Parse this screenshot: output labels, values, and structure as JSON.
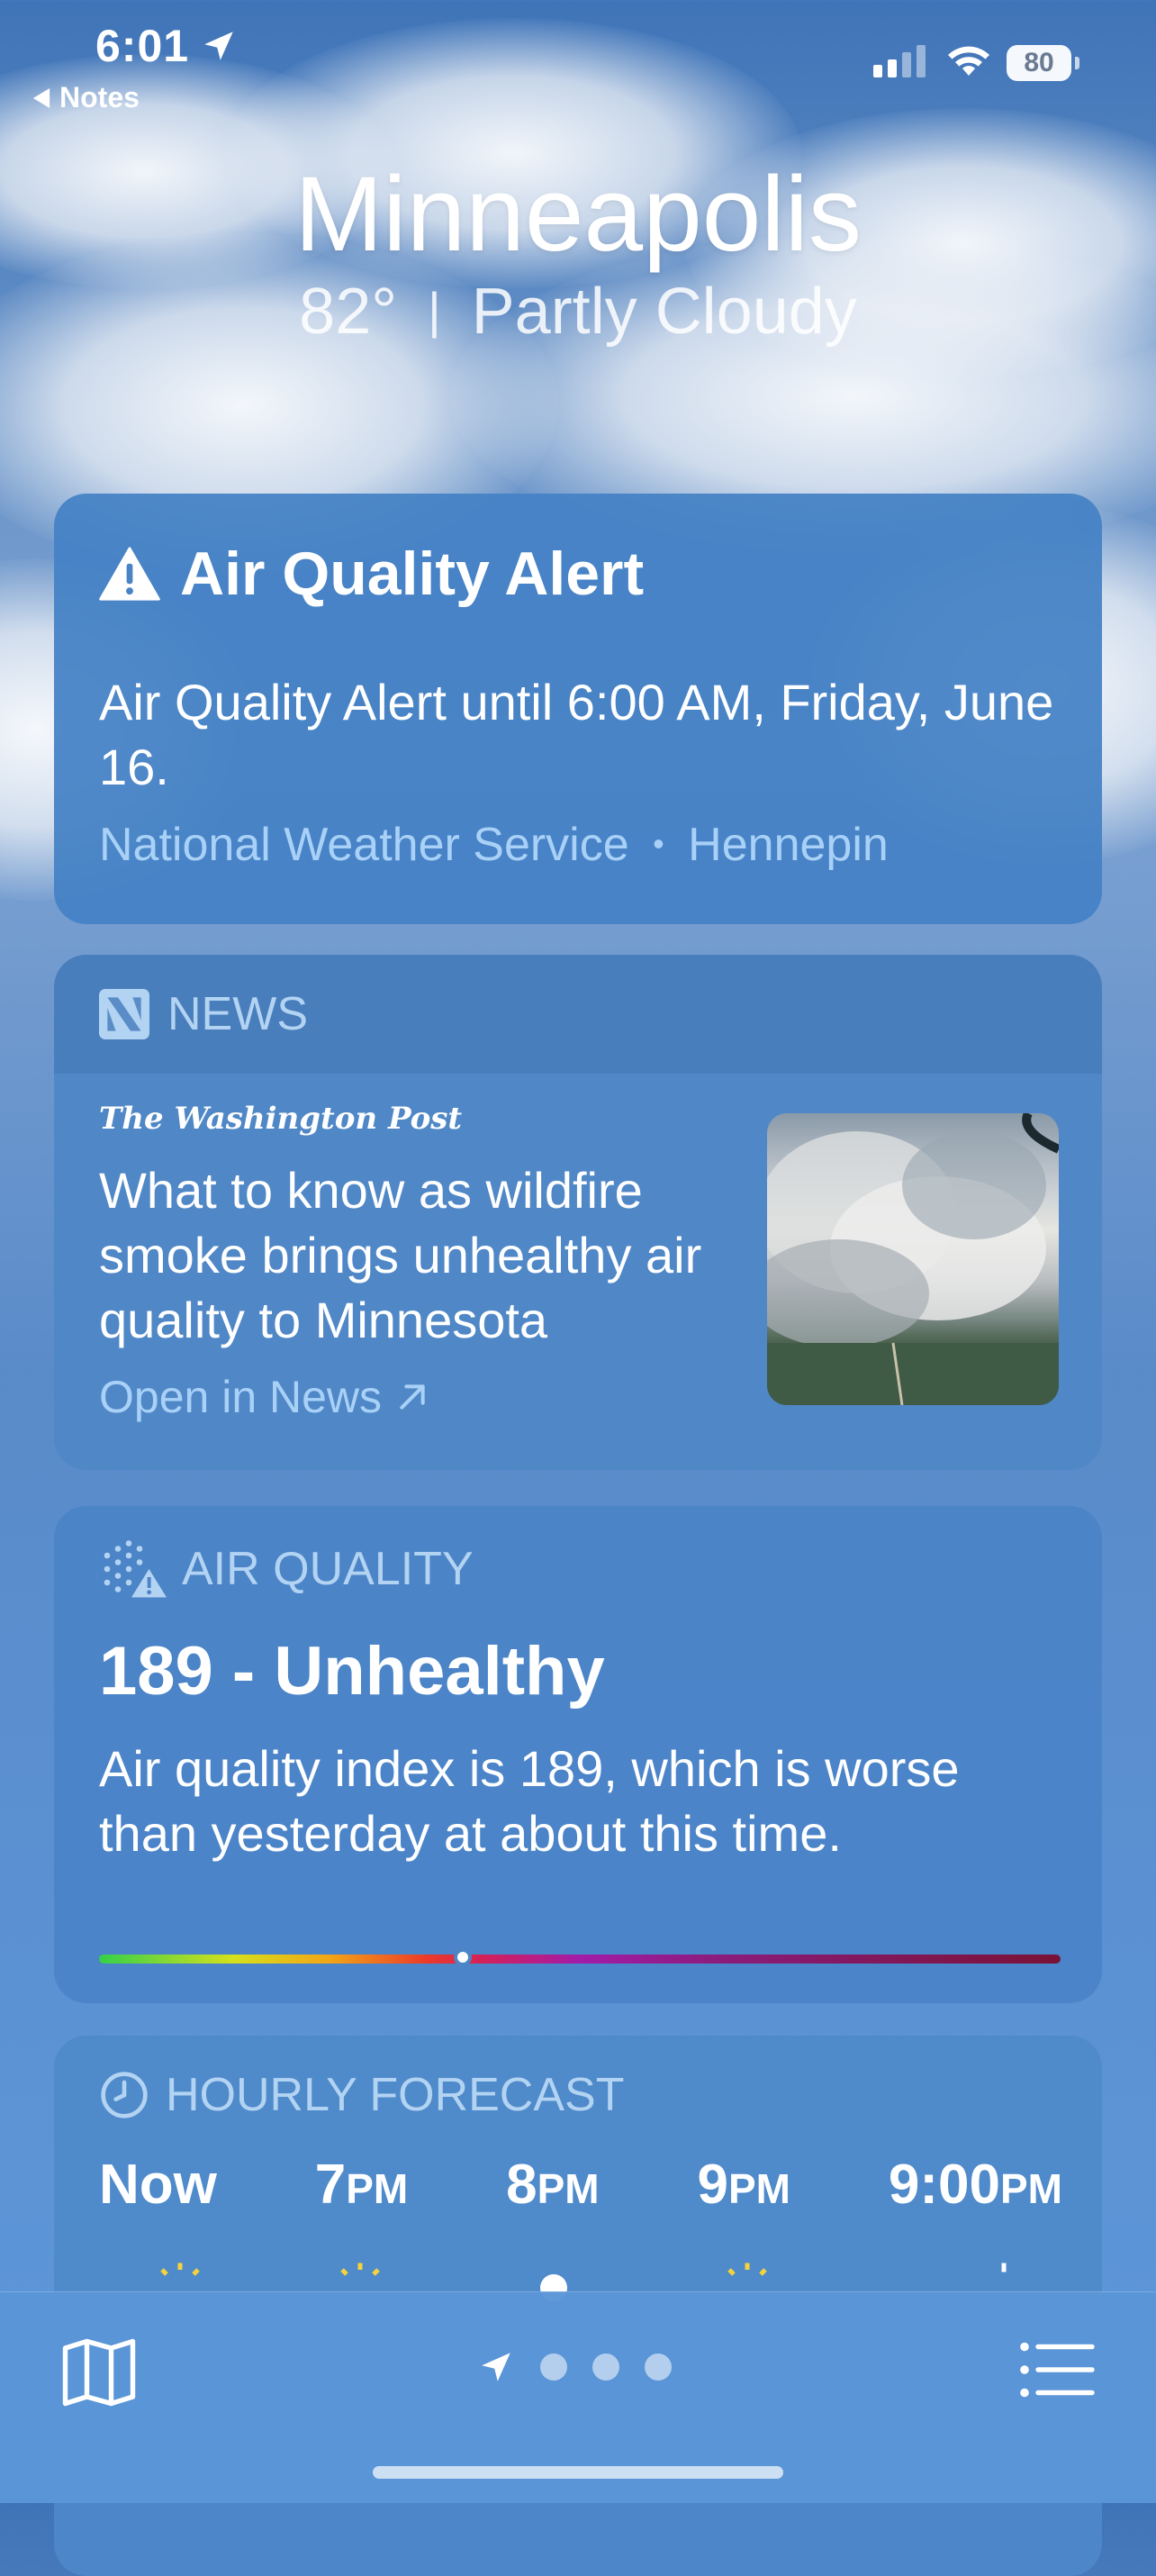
{
  "status_bar": {
    "time": "6:01",
    "back_label": "Notes",
    "battery": "80"
  },
  "header": {
    "city": "Minneapolis",
    "temperature": "82°",
    "separator": "|",
    "condition": "Partly Cloudy"
  },
  "alert": {
    "title": "Air Quality Alert",
    "body": "Air Quality Alert until 6:00 AM, Friday, June 16.",
    "source": "National Weather Service",
    "separator": "•",
    "region": "Hennepin",
    "icon": "warning-triangle-icon"
  },
  "news": {
    "section_label": "NEWS",
    "publisher": "The Washington Post",
    "headline": "What to know as wildfire smoke brings unhealthy air quality to Minnesota",
    "open_label": "Open in News",
    "icon": "news-icon"
  },
  "air_quality": {
    "section_label": "AIR QUALITY",
    "value_label": "189 - Unhealthy",
    "aqi": 189,
    "description": "Air quality index is 189, which is worse than yesterday at about this time.",
    "scale_position": 0.378
  },
  "hourly": {
    "section_label": "HOURLY FORECAST",
    "hours": [
      {
        "num": "Now",
        "ampm": ""
      },
      {
        "num": "7",
        "ampm": "PM"
      },
      {
        "num": "8",
        "ampm": "PM"
      },
      {
        "num": "9",
        "ampm": "PM"
      },
      {
        "num": "9:00",
        "ampm": "PM"
      }
    ]
  },
  "tab_bar": {
    "map_icon": "map-icon",
    "location_icon": "location-arrow-icon",
    "list_icon": "list-icon",
    "pages": 3
  },
  "colors": {
    "card": "#4a83c6",
    "secondary_text": "#a9d1f7",
    "header_text": "#b3d3f2"
  }
}
